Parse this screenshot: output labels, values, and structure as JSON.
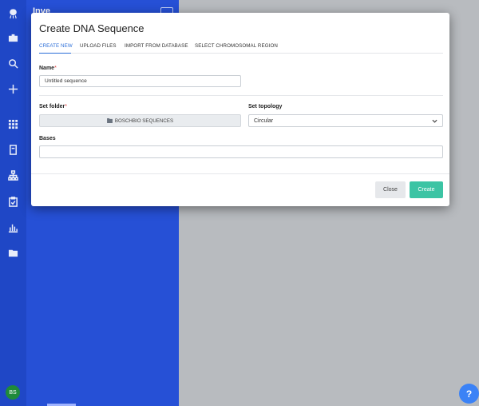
{
  "sidebar": {
    "app_title": "Inve",
    "avatar_initials": "BS",
    "icons": [
      "logo-icon",
      "briefcase-icon",
      "search-icon",
      "plus-icon",
      "grid-icon",
      "notebook-icon",
      "hierarchy-icon",
      "clipboard-icon",
      "chart-icon",
      "folder-user-icon"
    ]
  },
  "modal": {
    "title": "Create DNA Sequence",
    "tabs": [
      {
        "label": "CREATE NEW",
        "active": true
      },
      {
        "label": "UPLOAD FILES",
        "active": false
      },
      {
        "label": "IMPORT FROM DATABASE",
        "active": false
      },
      {
        "label": "SELECT CHROMOSOMAL REGION",
        "active": false
      }
    ],
    "name": {
      "label": "Name",
      "required": "*",
      "value": "Untitled sequence"
    },
    "folder": {
      "label": "Set folder",
      "required": "*",
      "value": "BOSCHBIO SEQUENCES"
    },
    "topology": {
      "label": "Set topology",
      "value": "Circular"
    },
    "bases": {
      "label": "Bases",
      "value": ""
    },
    "close_label": "Close",
    "create_label": "Create"
  },
  "help": {
    "label": "?"
  },
  "colors": {
    "rail": "#1f47c6",
    "panel": "#2650d6",
    "accent": "#2b6ed8",
    "create": "#3cc4a4"
  }
}
